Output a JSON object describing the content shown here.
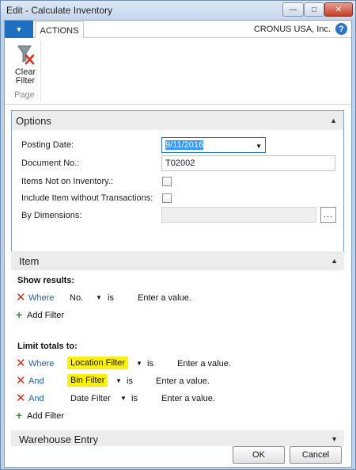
{
  "window": {
    "title": "Edit - Calculate Inventory",
    "min": "—",
    "max": "□",
    "close": "✕"
  },
  "ribbon": {
    "app_menu_icon": "▼",
    "tab_actions": "ACTIONS",
    "company": "CRONUS USA, Inc.",
    "help": "?",
    "clear_filter_label_1": "Clear",
    "clear_filter_label_2": "Filter",
    "group_label": "Page"
  },
  "options": {
    "title": "Options",
    "chevron": "▲",
    "posting_date_label": "Posting Date:",
    "posting_date_value": "9/11/2016",
    "document_no_label": "Document No.:",
    "document_no_value": "T02002",
    "items_not_on_inventory_label": "Items Not on Inventory.:",
    "include_item_label": "Include Item without Transactions:",
    "by_dimensions_label": "By Dimensions:",
    "by_dimensions_value": "",
    "assist": "..."
  },
  "item": {
    "title": "Item",
    "chevron": "▲",
    "show_results_label": "Show results:",
    "show_results_filters": [
      {
        "conj": "Where",
        "field": "No.",
        "op": "is",
        "value": "Enter a value."
      }
    ],
    "add_filter": "Add Filter",
    "limit_totals_label": "Limit totals to:",
    "limit_filters": [
      {
        "conj": "Where",
        "field": "Location Filter",
        "op": "is",
        "value": "Enter a value."
      },
      {
        "conj": "And",
        "field": "Bin Filter",
        "op": "is",
        "value": "Enter a value."
      },
      {
        "conj": "And",
        "field": "Date Filter",
        "op": "is",
        "value": "Enter a value."
      }
    ]
  },
  "warehouse": {
    "title": "Warehouse Entry",
    "chevron": "▼"
  },
  "footer": {
    "ok": "OK",
    "cancel": "Cancel"
  },
  "icons": {
    "remove_filter": "x-icon",
    "add_filter": "plus-icon",
    "clear_filter": "funnel-clear-icon"
  },
  "colors": {
    "highlight": "#fff200",
    "accent": "#1f6fbf",
    "remove": "#c8301b",
    "add": "#3a8d3a"
  }
}
